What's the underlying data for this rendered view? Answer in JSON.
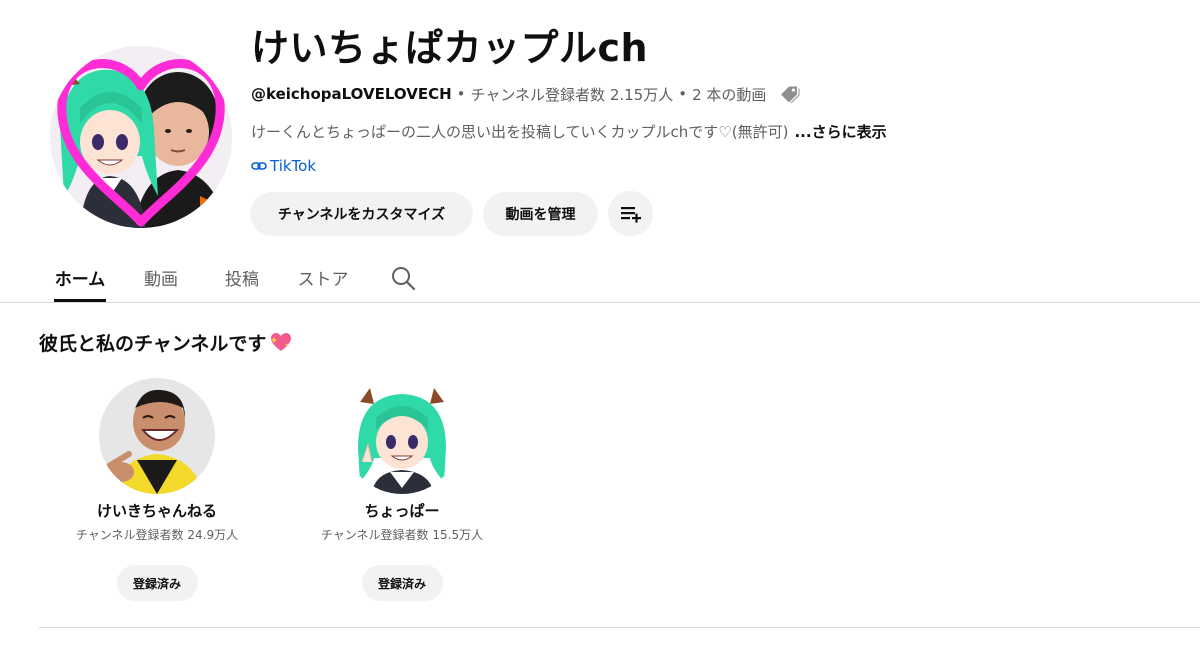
{
  "channel": {
    "title": "けいちょぱカップルch",
    "handle": "@keichopaLOVELOVECH",
    "subscribers": "チャンネル登録者数 2.15万人",
    "video_count": "2 本の動画",
    "separator": "•",
    "description": "けーくんとちょっぱーの二人の思い出を投稿していくカップルchです♡(無許可)",
    "more_label": "...さらに表示",
    "link_label": "TikTok",
    "avatar_icon": "couple-avatar",
    "tag_icon": "tag-icon",
    "link_icon": "link-icon"
  },
  "actions": {
    "customize_label": "チャンネルをカスタマイズ",
    "manage_label": "動画を管理",
    "playlist_icon": "playlist-add-icon"
  },
  "tabs": [
    {
      "label": "ホーム",
      "active": true
    },
    {
      "label": "動画",
      "active": false
    },
    {
      "label": "投稿",
      "active": false
    },
    {
      "label": "ストア",
      "active": false
    }
  ],
  "tab_search_icon": "search-icon",
  "section": {
    "title": "彼氏と私のチャンネルです",
    "emoji_icon": "sparkling-heart-icon"
  },
  "featured_channels": [
    {
      "name": "けいきちゃんねる",
      "subscribers": "チャンネル登録者数 24.9万人",
      "button_label": "登録済み",
      "avatar_icon": "laughing-man-avatar"
    },
    {
      "name": "ちょっぱー",
      "subscribers": "チャンネル登録者数 15.5万人",
      "button_label": "登録済み",
      "avatar_icon": "anime-girl-avatar"
    }
  ],
  "colors": {
    "accent_link": "#065fd4",
    "heart_frame": "#ff2bd6",
    "button_bg": "#f2f2f2",
    "muted_text": "#606060"
  }
}
